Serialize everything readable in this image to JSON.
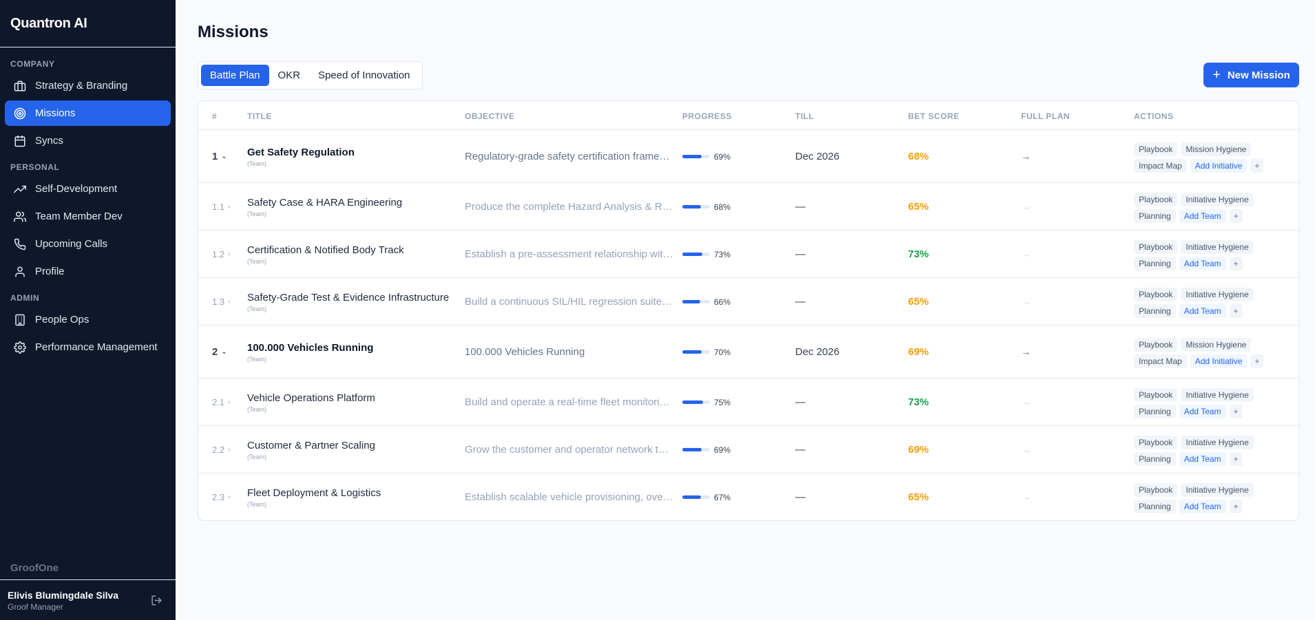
{
  "app": {
    "name": "Quantron AI",
    "footer_brand": "GroofOne"
  },
  "sidebar": {
    "company_label": "COMPANY",
    "company_items": [
      {
        "label": "Strategy & Branding",
        "icon": "briefcase-icon"
      },
      {
        "label": "Missions",
        "icon": "target-icon",
        "active": true
      },
      {
        "label": "Syncs",
        "icon": "calendar-icon"
      }
    ],
    "personal_label": "PERSONAL",
    "personal_items": [
      {
        "label": "Self-Development",
        "icon": "trending-up-icon"
      },
      {
        "label": "Team Member Dev",
        "icon": "users-icon"
      },
      {
        "label": "Upcoming Calls",
        "icon": "phone-icon"
      },
      {
        "label": "Profile",
        "icon": "user-icon"
      }
    ],
    "admin_label": "ADMIN",
    "admin_items": [
      {
        "label": "People Ops",
        "icon": "building-icon"
      },
      {
        "label": "Performance Management",
        "icon": "gear-icon"
      }
    ]
  },
  "user": {
    "name": "Elivis Blumingdale Silva",
    "role": "Groof Manager"
  },
  "page": {
    "title": "Missions",
    "new_button": "New Mission"
  },
  "tabs": [
    {
      "label": "Battle Plan",
      "active": true
    },
    {
      "label": "OKR"
    },
    {
      "label": "Speed of Innovation"
    }
  ],
  "table": {
    "headers": [
      "#",
      "TITLE",
      "OBJECTIVE",
      "PROGRESS",
      "TILL",
      "BET SCORE",
      "FULL PLAN",
      "ACTIONS"
    ],
    "rows": [
      {
        "num": "1",
        "parent": true,
        "title": "Get Safety Regulation",
        "sub": "(Team)",
        "objective": "Regulatory-grade safety certification framework for autonomous vehicles",
        "progress": 69,
        "progress_label": "69%",
        "till": "Dec 2026",
        "score": "68%",
        "score_color": "#f59e0b",
        "chips1": [
          "Playbook",
          "Mission Hygiene"
        ],
        "chips2": [
          "Impact Map"
        ],
        "link": "Add Initiative"
      },
      {
        "num": "1.1",
        "parent": false,
        "title": "Safety Case & HARA Engineering",
        "sub": "(Team)",
        "objective": "Produce the complete Hazard Analysis & Risk Assessment",
        "progress": 68,
        "progress_label": "68%",
        "till": "—",
        "score": "65%",
        "score_color": "#f59e0b",
        "chips1": [
          "Playbook",
          "Initiative Hygiene"
        ],
        "chips2": [
          "Planning"
        ],
        "link": "Add Team"
      },
      {
        "num": "1.2",
        "parent": false,
        "title": "Certification & Notified Body Track",
        "sub": "(Team)",
        "objective": "Establish a pre-assessment relationship with the notified body",
        "progress": 73,
        "progress_label": "73%",
        "till": "—",
        "score": "73%",
        "score_color": "#16a34a",
        "chips1": [
          "Playbook",
          "Initiative Hygiene"
        ],
        "chips2": [
          "Planning"
        ],
        "link": "Add Team"
      },
      {
        "num": "1.3",
        "parent": false,
        "title": "Safety-Grade Test & Evidence Infrastructure",
        "sub": "(Team)",
        "objective": "Build a continuous SIL/HIL regression suite with traceable evidence",
        "progress": 66,
        "progress_label": "66%",
        "till": "—",
        "score": "65%",
        "score_color": "#f59e0b",
        "chips1": [
          "Playbook",
          "Initiative Hygiene"
        ],
        "chips2": [
          "Planning"
        ],
        "link": "Add Team"
      },
      {
        "num": "2",
        "parent": true,
        "title": "100.000 Vehicles Running",
        "sub": "(Team)",
        "objective": "100.000 Vehicles Running",
        "progress": 70,
        "progress_label": "70%",
        "till": "Dec 2026",
        "score": "69%",
        "score_color": "#f59e0b",
        "chips1": [
          "Playbook",
          "Mission Hygiene"
        ],
        "chips2": [
          "Impact Map"
        ],
        "link": "Add Initiative"
      },
      {
        "num": "2.1",
        "parent": false,
        "title": "Vehicle Operations Platform",
        "sub": "(Team)",
        "objective": "Build and operate a real-time fleet monitoring platform",
        "progress": 75,
        "progress_label": "75%",
        "till": "—",
        "score": "73%",
        "score_color": "#16a34a",
        "chips1": [
          "Playbook",
          "Initiative Hygiene"
        ],
        "chips2": [
          "Planning"
        ],
        "link": "Add Team"
      },
      {
        "num": "2.2",
        "parent": false,
        "title": "Customer & Partner Scaling",
        "sub": "(Team)",
        "objective": "Grow the customer and operator network through partnerships",
        "progress": 69,
        "progress_label": "69%",
        "till": "—",
        "score": "69%",
        "score_color": "#f59e0b",
        "chips1": [
          "Playbook",
          "Initiative Hygiene"
        ],
        "chips2": [
          "Planning"
        ],
        "link": "Add Team"
      },
      {
        "num": "2.3",
        "parent": false,
        "title": "Fleet Deployment & Logistics",
        "sub": "(Team)",
        "objective": "Establish scalable vehicle provisioning, over-the-air updates",
        "progress": 67,
        "progress_label": "67%",
        "till": "—",
        "score": "65%",
        "score_color": "#f59e0b",
        "chips1": [
          "Playbook",
          "Initiative Hygiene"
        ],
        "chips2": [
          "Planning"
        ],
        "link": "Add Team"
      }
    ]
  }
}
